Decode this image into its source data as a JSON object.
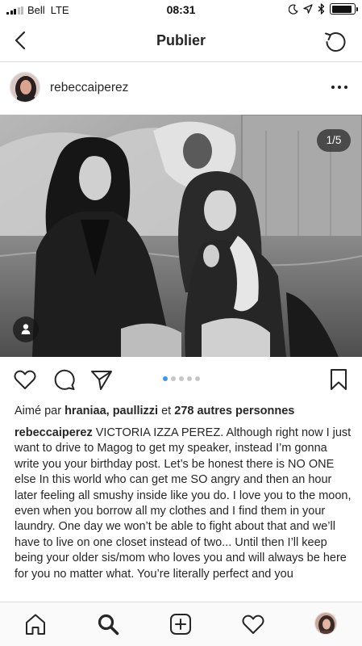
{
  "status_bar": {
    "carrier": "Bell",
    "network": "LTE",
    "time": "08:31",
    "battery_level": 0.92,
    "icons": [
      "signal-icon",
      "moon-icon",
      "location-arrow-icon",
      "bluetooth-icon",
      "battery-icon"
    ]
  },
  "nav": {
    "title": "Publier",
    "back_icon": "chevron-left-icon",
    "refresh_icon": "refresh-icon"
  },
  "post": {
    "username": "rebeccaiperez",
    "more_icon": "more-horizontal-icon",
    "media_counter": "1/5",
    "carousel_total": 5,
    "carousel_active_index": 0,
    "likes": {
      "prefix": "Aimé par ",
      "names": "hraniaa, paullizzi",
      "joiner": " et ",
      "others": "278 autres personnes"
    },
    "caption": {
      "username": "rebeccaiperez",
      "text": " VICTORIA IZZA PEREZ. Although right now I just want to drive to Magog to get my speaker, instead I’m gonna write you your birthday post. Let’s be honest there is NO ONE else In this world who can get me SO angry and then an hour later feeling all smushy inside like you do. I love you to the moon, even when you borrow all my clothes and I find them in your laundry. One day we won’t be able to fight about that and we’ll have to live on one closet instead of two... Until then I’ll keep being your older sis/mom who loves you and will always be here for you no matter what. You’re literally perfect and you"
    }
  },
  "tab_bar": {
    "items": [
      "home-icon",
      "search-icon",
      "add-post-icon",
      "activity-heart-icon",
      "profile-avatar"
    ]
  },
  "colors": {
    "text": "#262626",
    "border": "#dbdbdb",
    "accent_blue": "#3897f0",
    "dot_inactive": "#c7c7c7",
    "tabbar_bg": "#fafafa"
  }
}
